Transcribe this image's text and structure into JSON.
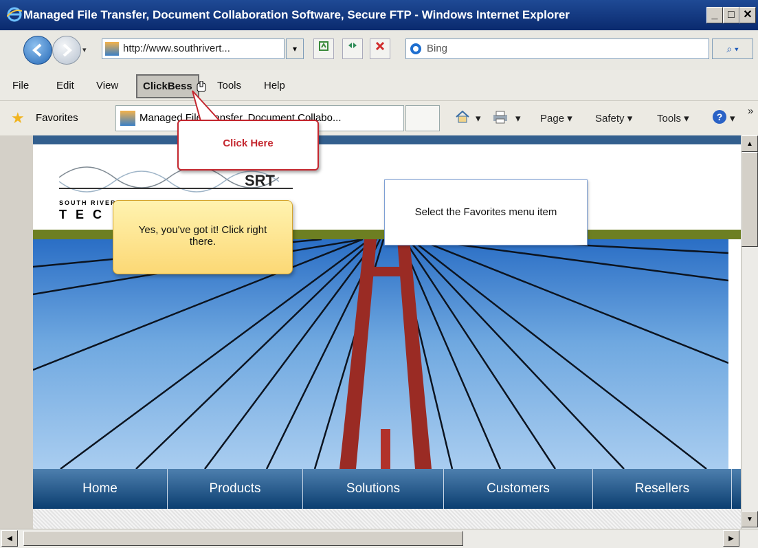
{
  "window": {
    "title": "Managed File Transfer, Document Collaboration Software, Secure FTP - Windows Internet Explorer",
    "controls": {
      "minimize": "_",
      "maximize": "□",
      "close": "✕"
    }
  },
  "address_bar": {
    "url": "http://www.southrivert...",
    "search_placeholder": "Bing",
    "search_button": "⌕ ▾",
    "dropdown_arrow": "▾"
  },
  "menu": {
    "items": [
      "File",
      "Edit",
      "View",
      "ClickBess",
      "Tools",
      "Help"
    ]
  },
  "favorites_bar": {
    "favorites_label": "Favorites",
    "tab_title": "Managed File Transfer, Document Collabo..."
  },
  "command_bar": {
    "page": "Page ▾",
    "safety": "Safety ▾",
    "tools": "Tools ▾",
    "more": "»",
    "home_arrow": "▾",
    "print_arrow": "▾",
    "help_arrow": "▾"
  },
  "website": {
    "logo_letters": "SRT",
    "logo_small": "SOUTH RIVER",
    "logo_large": "T E C",
    "nav": [
      "Home",
      "Products",
      "Solutions",
      "Customers",
      "Resellers"
    ]
  },
  "overlays": {
    "click_here": "Click Here",
    "yes_tooltip": "Yes, you've got it! Click right there.",
    "hint": "Select the Favorites menu item"
  },
  "colors": {
    "titlebar": "#0a2a6e",
    "callout_red": "#c4262e",
    "nav_blue": "#0b3e70",
    "green_bar": "#6d7f22"
  }
}
